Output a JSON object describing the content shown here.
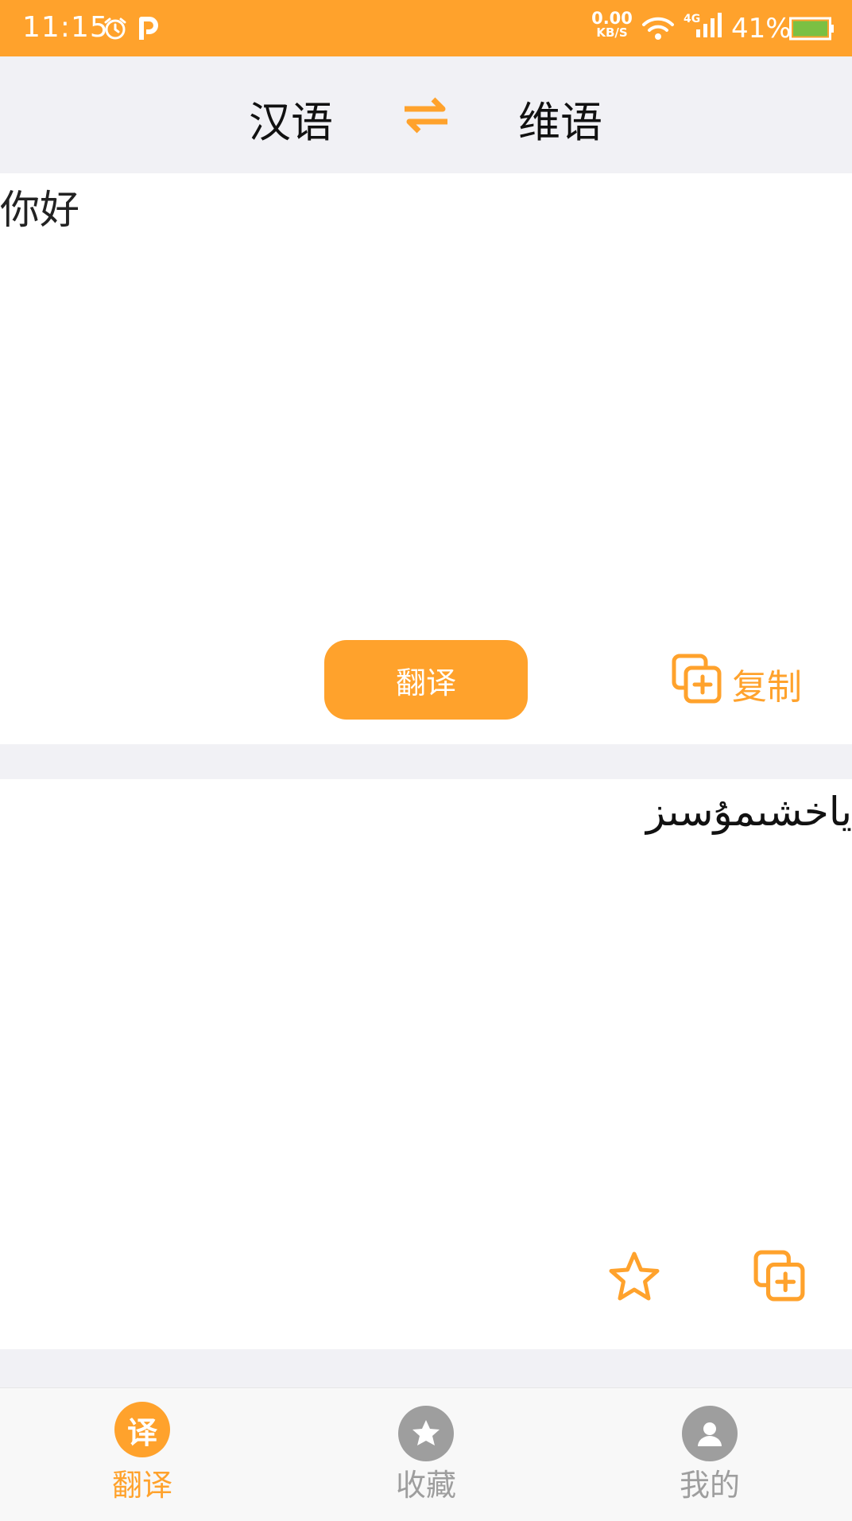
{
  "status_bar": {
    "time": "11:15",
    "net_speed_value": "0.00",
    "net_speed_unit": "KB/S",
    "network": "4G",
    "battery": "41%"
  },
  "header": {
    "source_lang": "汉语",
    "target_lang": "维语"
  },
  "input": {
    "text": "你好",
    "translate_label": "翻译",
    "copy_label": "复制"
  },
  "output": {
    "text": "ياخشىمۇسىز"
  },
  "nav": {
    "items": [
      {
        "label": "翻译",
        "icon_text": "译",
        "active": true
      },
      {
        "label": "收藏",
        "active": false
      },
      {
        "label": "我的",
        "active": false
      }
    ]
  },
  "colors": {
    "accent": "#ffa22c",
    "inactive": "#9e9e9e"
  }
}
